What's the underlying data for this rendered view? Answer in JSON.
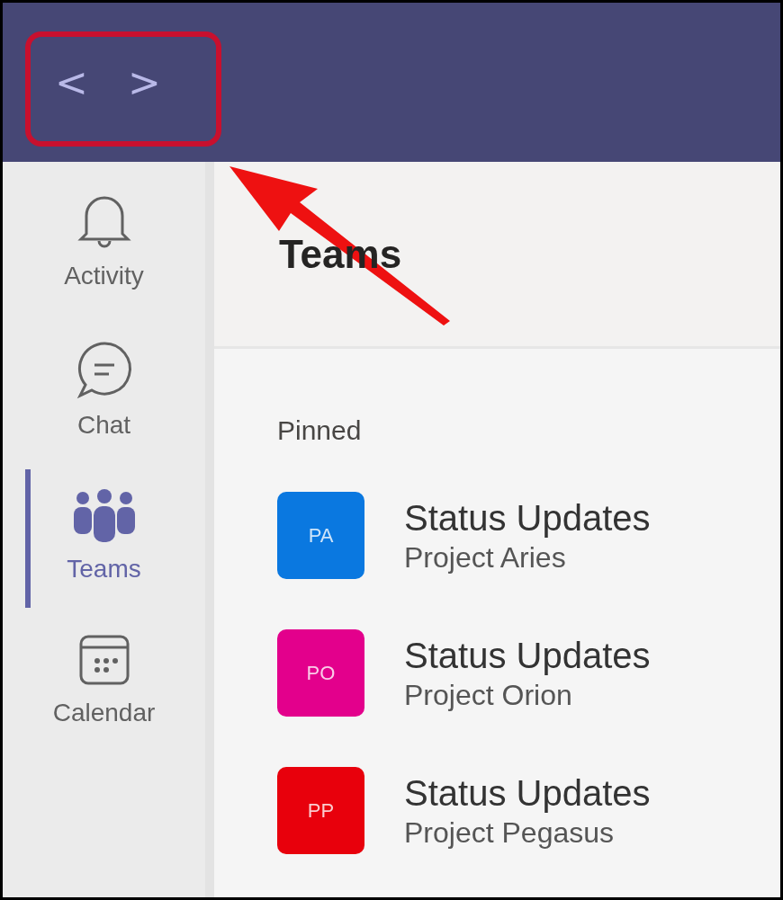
{
  "nav_buttons": {
    "back": "<",
    "forward": ">"
  },
  "rail": [
    {
      "kind": "activity",
      "label": "Activity",
      "selected": false
    },
    {
      "kind": "chat",
      "label": "Chat",
      "selected": false
    },
    {
      "kind": "teams",
      "label": "Teams",
      "selected": true
    },
    {
      "kind": "calendar",
      "label": "Calendar",
      "selected": false
    }
  ],
  "title": "Teams",
  "section": "Pinned",
  "teams": [
    {
      "initials": "PA",
      "color": "#0a78e0",
      "name": "Status Updates",
      "project": "Project Aries"
    },
    {
      "initials": "PO",
      "color": "#e3008c",
      "name": "Status Updates",
      "project": "Project Orion"
    },
    {
      "initials": "PP",
      "color": "#e8000c",
      "name": "Status Updates",
      "project": "Project Pegasus"
    }
  ]
}
